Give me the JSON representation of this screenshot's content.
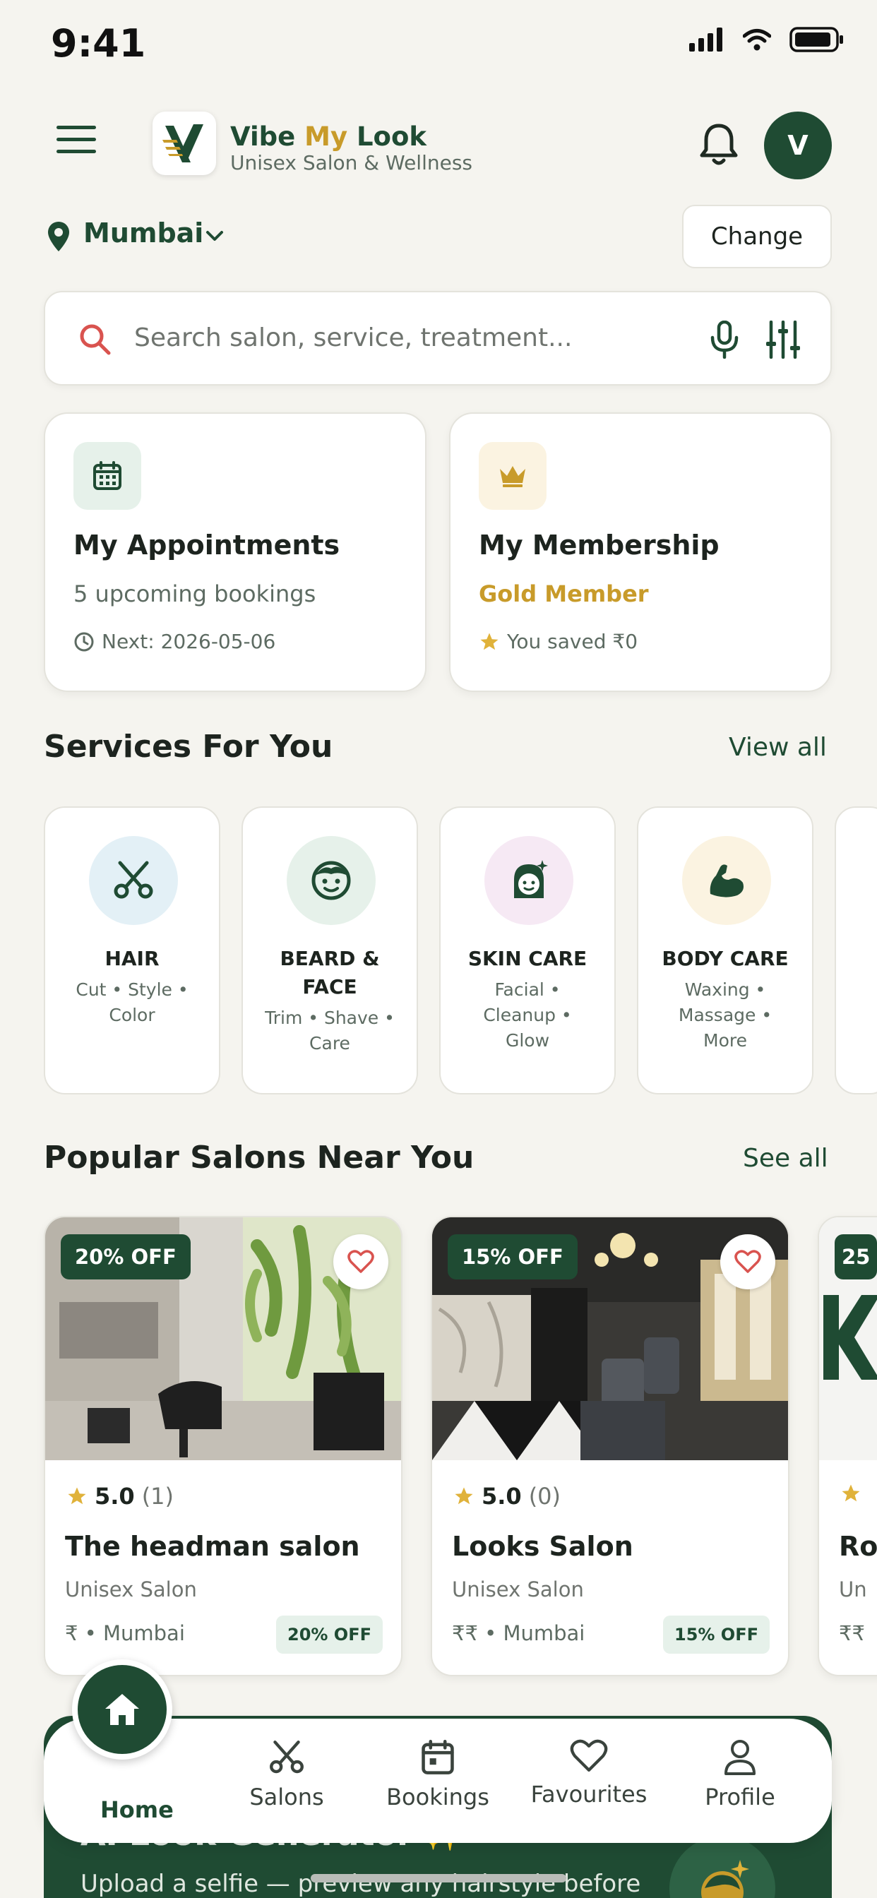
{
  "status_bar": {
    "time": "9:41"
  },
  "header": {
    "brand_part1": "Vibe ",
    "brand_part2": "My",
    "brand_part3": " Look",
    "tagline": "Unisex Salon & Wellness",
    "avatar_initial": "V"
  },
  "location": {
    "city": "Mumbai",
    "change_label": "Change"
  },
  "search": {
    "placeholder": "Search salon, service, treatment..."
  },
  "quick_cards": {
    "appointments": {
      "title": "My Appointments",
      "subtitle": "5 upcoming bookings",
      "meta": "Next: 2026-05-06"
    },
    "membership": {
      "title": "My Membership",
      "subtitle": "Gold Member",
      "meta": "You saved ₹0"
    }
  },
  "services": {
    "title": "Services For You",
    "view_all": "View all",
    "items": [
      {
        "name_l1": "HAIR",
        "name_l2": "",
        "desc_l1": "Cut • Style •",
        "desc_l2": "Color",
        "desc_l3": "",
        "icon": "scissors-icon",
        "bg": "#e3f0f6"
      },
      {
        "name_l1": "BEARD &",
        "name_l2": "FACE",
        "desc_l1": "Trim • Shave •",
        "desc_l2": "Care",
        "desc_l3": "",
        "icon": "face-icon",
        "bg": "#e6f1ea"
      },
      {
        "name_l1": "SKIN CARE",
        "name_l2": "",
        "desc_l1": "Facial •",
        "desc_l2": "Cleanup •",
        "desc_l3": "Glow",
        "icon": "sparkle-face-icon",
        "bg": "#f6e9f4"
      },
      {
        "name_l1": "BODY CARE",
        "name_l2": "",
        "desc_l1": "Waxing •",
        "desc_l2": "Massage •",
        "desc_l3": "More",
        "icon": "muscle-icon",
        "bg": "#fbf3e1"
      }
    ]
  },
  "salons": {
    "title": "Popular Salons Near You",
    "see_all": "See all",
    "items": [
      {
        "off": "20% OFF",
        "rating": "5.0",
        "count": "(1)",
        "name": "The headman salon",
        "type": "Unisex Salon",
        "price_loc": "₹ • Mumbai",
        "badge": "20% OFF"
      },
      {
        "off": "15% OFF",
        "rating": "5.0",
        "count": "(0)",
        "name": "Looks Salon",
        "type": "Unisex Salon",
        "price_loc": "₹₹ • Mumbai",
        "badge": "15% OFF"
      },
      {
        "off": "25",
        "rating": "",
        "count": "",
        "name": "Ro",
        "type": "Un",
        "price_loc": "₹₹",
        "badge": ""
      }
    ]
  },
  "ai_banner": {
    "title": "AI Look Generator ✨",
    "subtitle": "Upload a selfie — preview any hairstyle before"
  },
  "bottom_nav": {
    "home": "Home",
    "salons": "Salons",
    "bookings": "Bookings",
    "favourites": "Favourites",
    "profile": "Profile"
  },
  "colors": {
    "brand": "#1f4b33",
    "gold": "#c89b2a",
    "background": "#f5f4ef"
  }
}
